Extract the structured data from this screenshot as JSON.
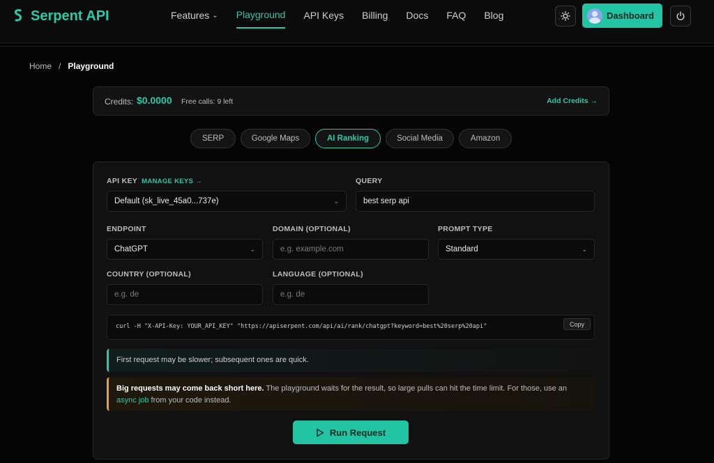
{
  "brand": {
    "name": "Serpent API"
  },
  "nav": {
    "items": [
      {
        "label": "Features",
        "has_dropdown": true
      },
      {
        "label": "Playground",
        "active": true
      },
      {
        "label": "API Keys"
      },
      {
        "label": "Billing"
      },
      {
        "label": "Docs"
      },
      {
        "label": "FAQ"
      },
      {
        "label": "Blog"
      }
    ],
    "dashboard_label": "Dashboard"
  },
  "breadcrumb": {
    "home": "Home",
    "separator": "/",
    "current": "Playground"
  },
  "credits": {
    "label": "Credits:",
    "value": "$0.0000",
    "free_calls": "Free calls: 9 left",
    "add_label": "Add Credits →"
  },
  "tabs": [
    {
      "label": "SERP"
    },
    {
      "label": "Google Maps"
    },
    {
      "label": "AI Ranking",
      "active": true
    },
    {
      "label": "Social Media"
    },
    {
      "label": "Amazon"
    }
  ],
  "form": {
    "api_key": {
      "label": "API KEY",
      "manage": "MANAGE KEYS →",
      "value": "Default (sk_live_45a0...737e)"
    },
    "query": {
      "label": "QUERY",
      "value": "best serp api"
    },
    "endpoint": {
      "label": "ENDPOINT",
      "value": "ChatGPT"
    },
    "domain": {
      "label": "DOMAIN (OPTIONAL)",
      "placeholder": "e.g. example.com"
    },
    "prompt_type": {
      "label": "PROMPT TYPE",
      "value": "Standard"
    },
    "country": {
      "label": "COUNTRY (OPTIONAL)",
      "placeholder": "e.g. de"
    },
    "language": {
      "label": "LANGUAGE (OPTIONAL)",
      "placeholder": "e.g. de"
    }
  },
  "curl": {
    "command": "curl -H \"X-API-Key: YOUR_API_KEY\" \"https://apiserpent.com/api/ai/rank/chatgpt?keyword=best%20serp%20api\"",
    "copy_label": "Copy"
  },
  "notices": {
    "info": "First request may be slower; subsequent ones are quick.",
    "warn_bold": "Big requests may come back short here.",
    "warn_text": " The playground waits for the result, so large pulls can hit the time limit. For those, use an ",
    "warn_link": "async job",
    "warn_tail": " from your code instead."
  },
  "run_label": "Run Request",
  "colors": {
    "accent": "#22c4a3",
    "warning": "#e6a23c",
    "background": "#050505"
  }
}
